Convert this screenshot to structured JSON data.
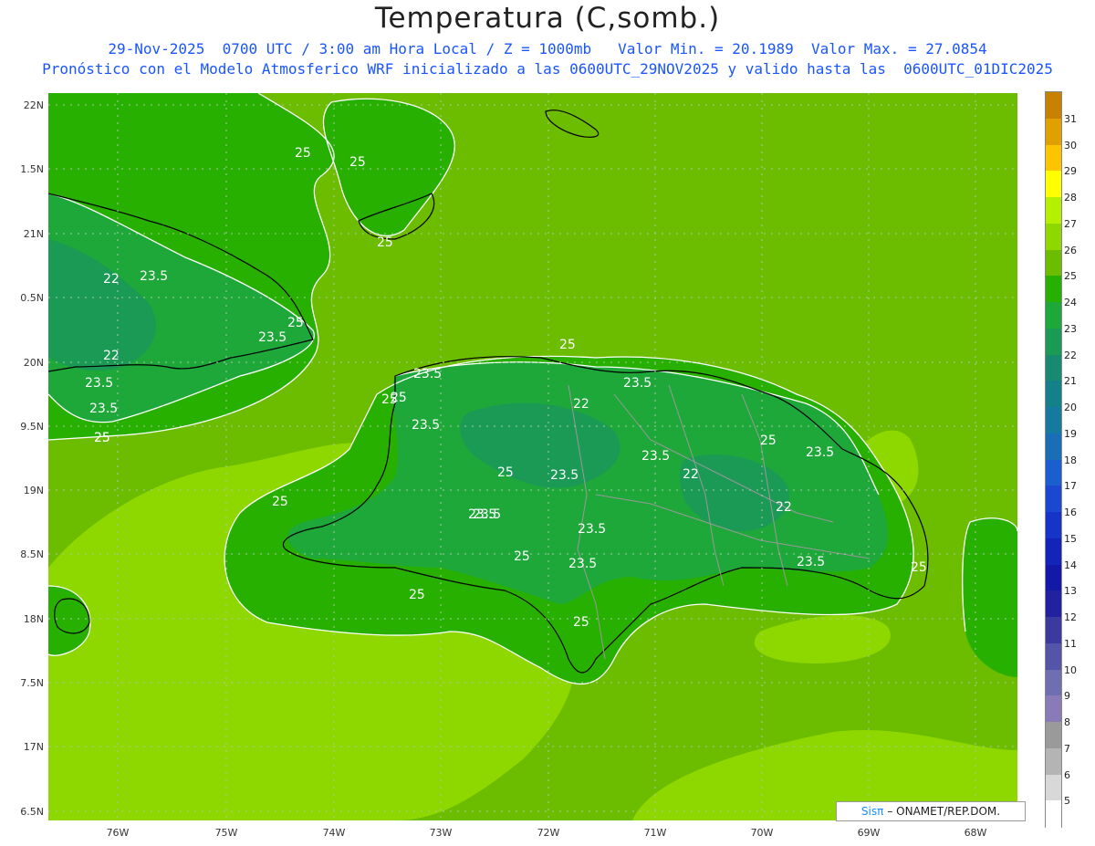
{
  "header": {
    "title": "Temperatura (C,somb.)",
    "line1": "29-Nov-2025  0700 UTC / 3:00 am Hora Local / Z = 1000mb   Valor Min. = 20.1989  Valor Max. = 27.0854",
    "line2": "Pronóstico con el Modelo Atmosferico WRF inicializado a las 0600UTC_29NOV2025 y valido hasta las  0600UTC_01DIC2025"
  },
  "axes": {
    "lat_labels": [
      "22N",
      "1.5N",
      "21N",
      "0.5N",
      "20N",
      "9.5N",
      "19N",
      "8.5N",
      "18N",
      "7.5N",
      "17N",
      "6.5N"
    ],
    "lon_labels": [
      "76W",
      "75W",
      "74W",
      "73W",
      "72W",
      "71W",
      "70W",
      "69W",
      "68W"
    ]
  },
  "colorbar": {
    "labels": [
      "31",
      "30",
      "29",
      "28",
      "27",
      "26",
      "25",
      "24",
      "23",
      "22",
      "21",
      "20",
      "19",
      "18",
      "17",
      "16",
      "15",
      "14",
      "13",
      "12",
      "11",
      "10",
      "9",
      "8",
      "7",
      "6",
      "5"
    ],
    "colors": [
      "#c88000",
      "#e0a000",
      "#ffc400",
      "#ffff00",
      "#b4f000",
      "#8ed800",
      "#6cbc00",
      "#27b000",
      "#1ea83a",
      "#1a9a55",
      "#178a70",
      "#14808a",
      "#167aa0",
      "#1a6eb8",
      "#1a5ed0",
      "#1a48d0",
      "#1634c8",
      "#1424b8",
      "#1418a8",
      "#2222a0",
      "#3a3aa0",
      "#5454a8",
      "#6e6eb0",
      "#8a7ab8",
      "#9a9a9a",
      "#b4b4b4",
      "#d8d8d8",
      "#ffffff"
    ]
  },
  "contour_labels": [
    "25",
    "25",
    "25",
    "22",
    "23.5",
    "25",
    "23.5",
    "22",
    "23.5",
    "23.5",
    "25",
    "25",
    "23.5",
    "25",
    "23.5",
    "22",
    "23.5",
    "25",
    "23.5",
    "22",
    "23.5",
    "22",
    "23.5",
    "25",
    "23.5",
    "23.5",
    "25",
    "25",
    "25",
    "23.5",
    "25",
    "25",
    "23.5",
    "25",
    "23.5",
    "25"
  ],
  "credit": {
    "sis": "Sisπ",
    "org": "– ONAMET/REP.DOM."
  }
}
